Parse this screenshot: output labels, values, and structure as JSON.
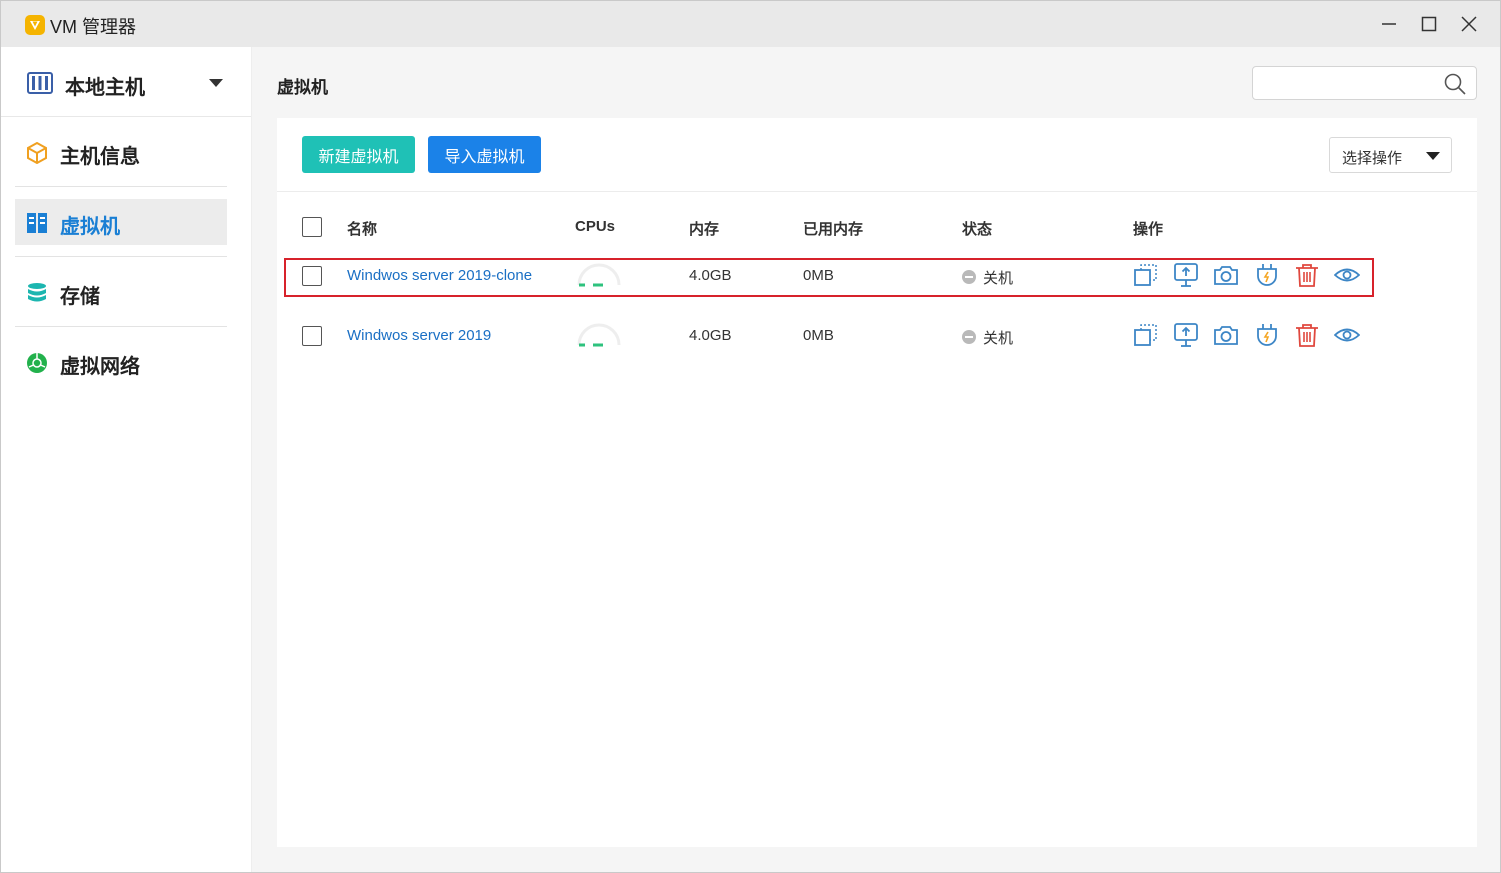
{
  "window": {
    "title": "VM 管理器",
    "colors": {
      "accent": "#1a7fd4",
      "teal": "#1fc1b6",
      "blue": "#1b82e8",
      "danger": "#e0483e"
    }
  },
  "sidebar": {
    "host_label": "本地主机",
    "items": [
      {
        "label": "主机信息",
        "icon": "host-info-icon",
        "active": false
      },
      {
        "label": "虚拟机",
        "icon": "vm-icon",
        "active": true
      },
      {
        "label": "存储",
        "icon": "storage-icon",
        "active": false
      },
      {
        "label": "虚拟网络",
        "icon": "network-icon",
        "active": false
      }
    ]
  },
  "main": {
    "title": "虚拟机",
    "search": {
      "value": "",
      "placeholder": ""
    },
    "toolbar": {
      "new_vm": "新建虚拟机",
      "import_vm": "导入虚拟机",
      "operation_select": "选择操作"
    },
    "table": {
      "headers": {
        "name": "名称",
        "cpus": "CPUs",
        "memory": "内存",
        "used_memory": "已用内存",
        "status": "状态",
        "actions": "操作"
      },
      "rows": [
        {
          "name": "Windwos server 2019-clone",
          "memory": "4.0GB",
          "used_memory": "0MB",
          "status": "关机",
          "highlighted": true
        },
        {
          "name": "Windwos server 2019",
          "memory": "4.0GB",
          "used_memory": "0MB",
          "status": "关机",
          "highlighted": false
        }
      ],
      "row_actions": [
        "clone-icon",
        "export-icon",
        "snapshot-icon",
        "power-icon",
        "delete-icon",
        "view-icon"
      ]
    }
  }
}
